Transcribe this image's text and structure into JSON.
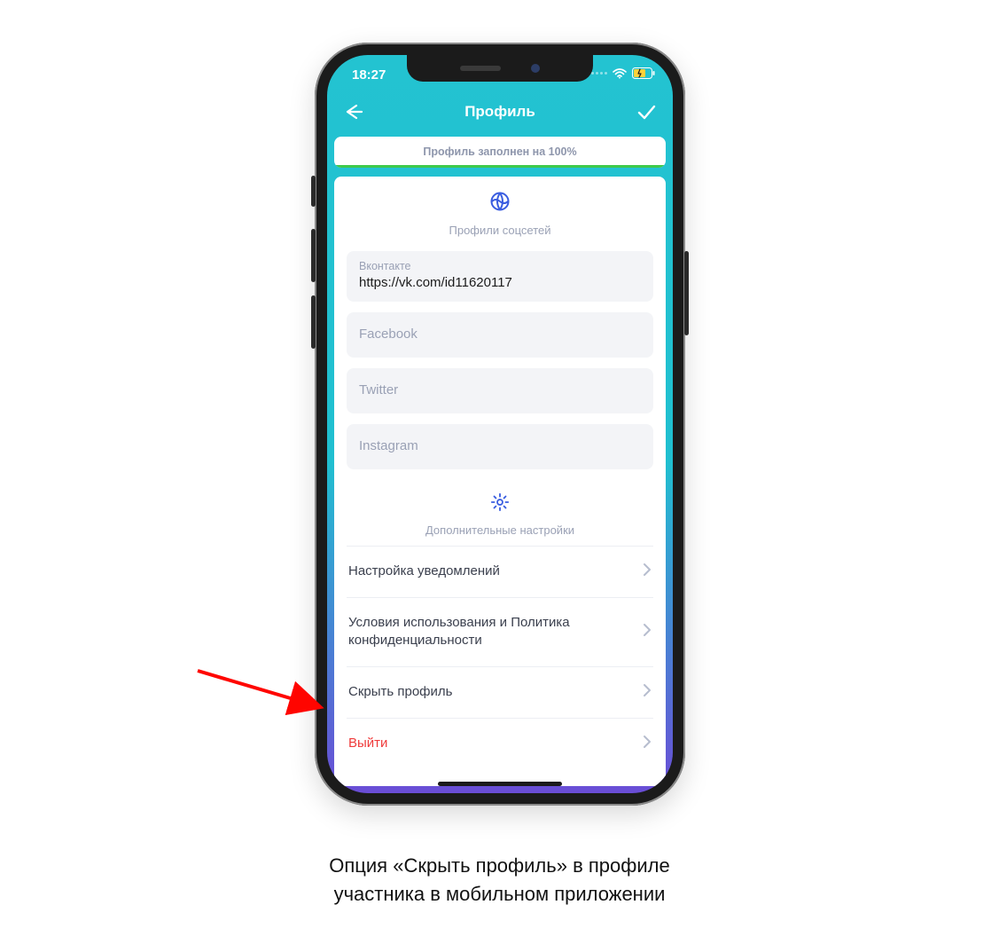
{
  "status": {
    "time": "18:27"
  },
  "header": {
    "title": "Профиль"
  },
  "progress": {
    "text": "Профиль заполнен на 100%"
  },
  "social": {
    "section_title": "Профили соцсетей",
    "vk_label": "Вконтакте",
    "vk_value": "https://vk.com/id11620117",
    "fb_placeholder": "Facebook",
    "tw_placeholder": "Twitter",
    "ig_placeholder": "Instagram"
  },
  "settings": {
    "section_title": "Дополнительные настройки",
    "notifications": "Настройка уведомлений",
    "terms": "Условия использования и Политика конфиденциальности",
    "hide_profile": "Скрыть профиль",
    "logout": "Выйти"
  },
  "caption": {
    "line1": "Опция «Скрыть профиль» в профиле",
    "line2": "участника в мобильном приложении"
  }
}
